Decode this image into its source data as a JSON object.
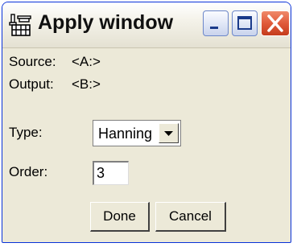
{
  "window": {
    "title": "Apply window",
    "title_icon": "pipe-fitting-icon",
    "controls": {
      "minimize_icon": "minimize-icon",
      "maximize_icon": "maximize-icon",
      "close_icon": "close-icon",
      "close_color": "#d8512e"
    }
  },
  "form": {
    "source_label": "Source:",
    "source_value": "<A:>",
    "output_label": "Output:",
    "output_value": "<B:>",
    "type_label": "Type:",
    "type_value": "Hanning",
    "order_label": "Order:",
    "order_value": "3"
  },
  "buttons": {
    "done_label": "Done",
    "cancel_label": "Cancel"
  }
}
